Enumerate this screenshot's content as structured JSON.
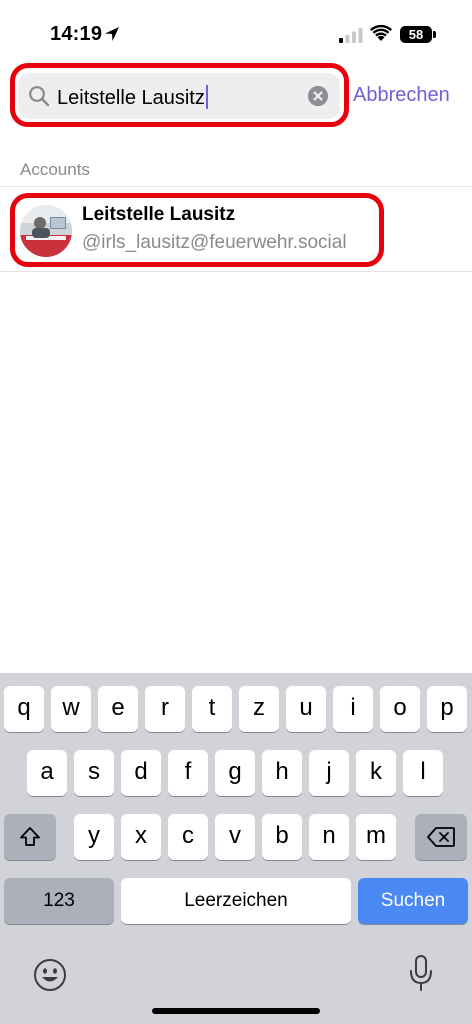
{
  "status_bar": {
    "time": "14:19",
    "battery": "58",
    "icons": [
      "location-arrow-icon",
      "cellular-signal-icon",
      "wifi-icon",
      "battery-icon"
    ]
  },
  "search": {
    "value": "Leitstelle Lausitz",
    "cancel_label": "Abbrechen",
    "icons": [
      "magnifier-icon",
      "clear-text-icon"
    ]
  },
  "accounts": {
    "header": "Accounts",
    "items": [
      {
        "display_name": "Leitstelle Lausitz",
        "handle": "@irls_lausitz@feuerwehr.social"
      }
    ]
  },
  "keyboard": {
    "row1": [
      "q",
      "w",
      "e",
      "r",
      "t",
      "z",
      "u",
      "i",
      "o",
      "p"
    ],
    "row2": [
      "a",
      "s",
      "d",
      "f",
      "g",
      "h",
      "j",
      "k",
      "l"
    ],
    "row3": [
      "y",
      "x",
      "c",
      "v",
      "b",
      "n",
      "m"
    ],
    "numbers_label": "123",
    "space_label": "Leerzeichen",
    "action_label": "Suchen",
    "icons": [
      "shift-icon",
      "backspace-icon",
      "emoji-icon",
      "microphone-icon"
    ]
  },
  "colors": {
    "accent": "#6e62d3",
    "highlight_ring": "#e8000d",
    "keyboard_action": "#4a89f3",
    "secondary_text": "#8a8a8e"
  }
}
